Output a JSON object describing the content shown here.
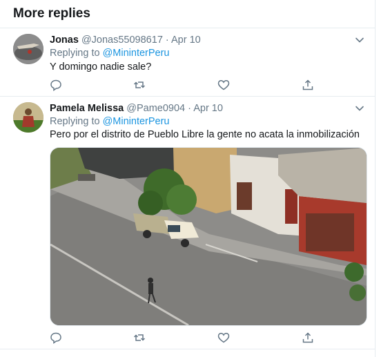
{
  "section": {
    "title": "More replies"
  },
  "replies": [
    {
      "name": "Jonas",
      "handle": "@Jonas55098617",
      "separator": "·",
      "date": "Apr 10",
      "replying_prefix": "Replying to",
      "replying_to": "@MininterPeru",
      "text": "Y domingo nadie sale?",
      "avatar_icon": "user-photo-avatar"
    },
    {
      "name": "Pamela Melissa",
      "handle": "@Pame0904",
      "separator": "·",
      "date": "Apr 10",
      "replying_prefix": "Replying to",
      "replying_to": "@MininterPeru",
      "text": "Pero por el distrito de Pueblo Libre la gente no acata la inmobilización",
      "avatar_icon": "user-photo-avatar",
      "media": "street-photo"
    }
  ],
  "actions": [
    "reply-icon",
    "retweet-icon",
    "like-icon",
    "share-icon"
  ],
  "colors": {
    "accent": "#1b95e0",
    "secondary_text": "#657786",
    "divider": "#e6ecf0"
  }
}
